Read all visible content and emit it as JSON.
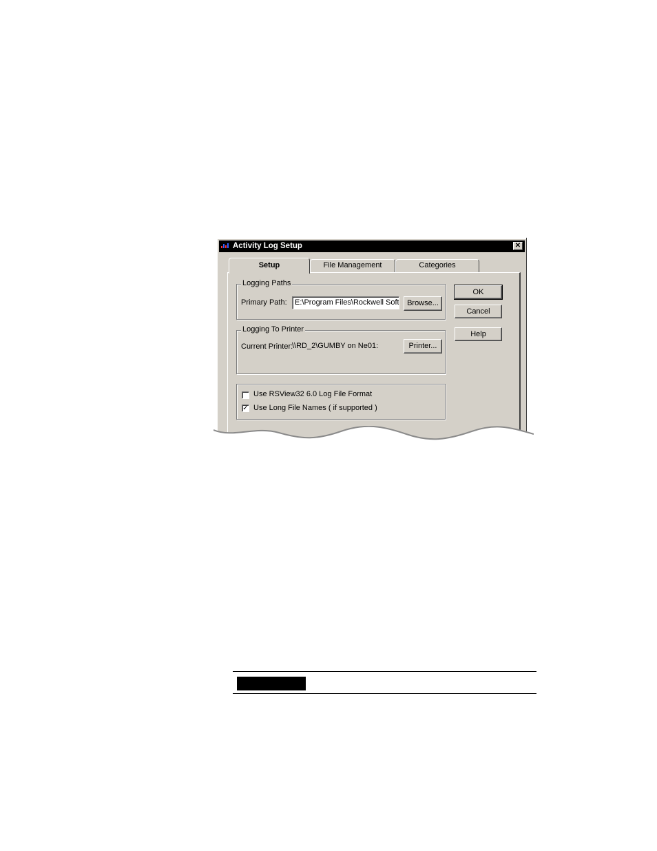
{
  "window": {
    "title": "Activity Log Setup",
    "close_glyph": "✕",
    "icon": "rsview-app-icon"
  },
  "tabs": [
    {
      "label": "Setup",
      "active": true
    },
    {
      "label": "File Management",
      "active": false
    },
    {
      "label": "Categories",
      "active": false
    }
  ],
  "logging_paths": {
    "group_label": "Logging Paths",
    "primary_path_label": "Primary Path:",
    "primary_path_value": "E:\\Program Files\\Rockwell Softw",
    "browse_label": "Browse..."
  },
  "logging_printer": {
    "group_label": "Logging To Printer",
    "current_printer_label": "Current Printer:",
    "current_printer_value": "\\\\RD_2\\GUMBY on Ne01:",
    "printer_button_label": "Printer..."
  },
  "options": {
    "rsview_format": {
      "label": "Use RSView32 6.0 Log File Format",
      "checked": false
    },
    "long_names": {
      "label": "Use Long File Names ( if supported )",
      "checked": true
    },
    "check_glyph": "✓"
  },
  "buttons": {
    "ok": "OK",
    "cancel": "Cancel",
    "help": "Help"
  }
}
